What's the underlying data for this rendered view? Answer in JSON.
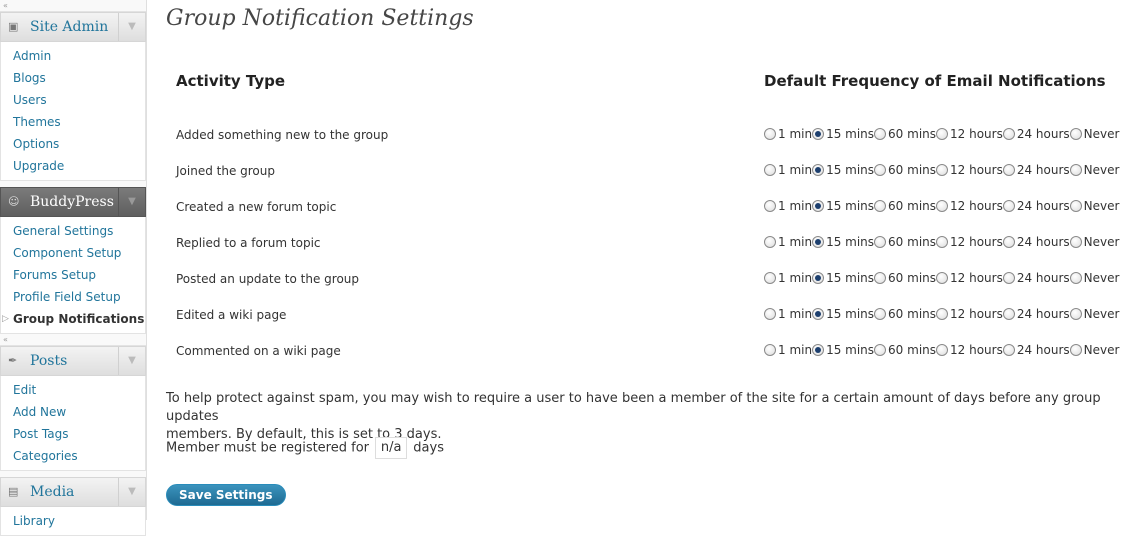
{
  "sidebar": {
    "groups": [
      {
        "title": "Site Admin",
        "icon": "site-admin-icon",
        "items": [
          "Admin",
          "Blogs",
          "Users",
          "Themes",
          "Options",
          "Upgrade"
        ]
      },
      {
        "title": "BuddyPress",
        "icon": "user-icon",
        "items": [
          "General Settings",
          "Component Setup",
          "Forums Setup",
          "Profile Field Setup",
          "Group Notifications"
        ],
        "current": "Group Notifications"
      },
      {
        "title": "Posts",
        "icon": "pushpin-icon",
        "items": [
          "Edit",
          "Add New",
          "Post Tags",
          "Categories"
        ]
      },
      {
        "title": "Media",
        "icon": "media-icon",
        "items": [
          "Library"
        ]
      }
    ]
  },
  "page": {
    "title": "Group Notification Settings",
    "col_activity": "Activity Type",
    "col_frequency": "Default Frequency of Email Notifications",
    "frequency_options": [
      "1 min",
      "15 mins",
      "60 mins",
      "12 hours",
      "24 hours",
      "Never"
    ],
    "activities": [
      {
        "label": "Added something new to the group",
        "selected": "15 mins"
      },
      {
        "label": "Joined the group",
        "selected": "15 mins"
      },
      {
        "label": "Created a new forum topic",
        "selected": "15 mins"
      },
      {
        "label": "Replied to a forum topic",
        "selected": "15 mins"
      },
      {
        "label": "Posted an update to the group",
        "selected": "15 mins"
      },
      {
        "label": "Edited a wiki page",
        "selected": "15 mins"
      },
      {
        "label": "Commented on a wiki page",
        "selected": "15 mins"
      }
    ],
    "spam_note": "To help protect against spam, you may wish to require a user to have been a member of the site for a certain amount of days before any group updates\nmembers. By default, this is set to 3 days.",
    "member_prefix": "Member must be registered for",
    "member_value": "n/a",
    "member_suffix": "days",
    "save_label": "Save Settings"
  },
  "colors": {
    "link": "#21759b",
    "button": "#21759b",
    "header_dark": "#6d6d6d"
  }
}
